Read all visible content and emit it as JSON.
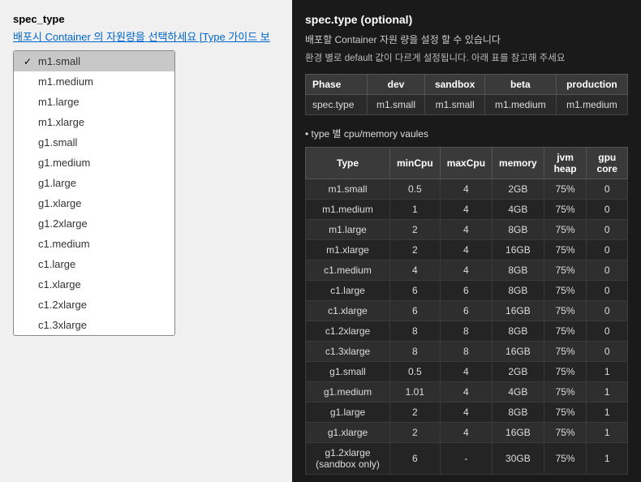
{
  "leftPanel": {
    "fieldLabel": "spec_type",
    "fieldSubtitle": "배포시 Container 의 자원량을 선택하세요 [Type 가이드 보",
    "items": [
      {
        "value": "m1.small",
        "selected": true
      },
      {
        "value": "m1.medium",
        "selected": false
      },
      {
        "value": "m1.large",
        "selected": false
      },
      {
        "value": "m1.xlarge",
        "selected": false
      },
      {
        "value": "g1.small",
        "selected": false
      },
      {
        "value": "g1.medium",
        "selected": false
      },
      {
        "value": "g1.large",
        "selected": false
      },
      {
        "value": "g1.xlarge",
        "selected": false
      },
      {
        "value": "g1.2xlarge",
        "selected": false
      },
      {
        "value": "c1.medium",
        "selected": false
      },
      {
        "value": "c1.large",
        "selected": false
      },
      {
        "value": "c1.xlarge",
        "selected": false
      },
      {
        "value": "c1.2xlarge",
        "selected": false
      },
      {
        "value": "c1.3xlarge",
        "selected": false
      }
    ]
  },
  "rightPanel": {
    "title": "spec.type (optional)",
    "desc": "배포할 Container 자원 량을 설정 할 수 있습니다",
    "note": "환경 별로 default 값이 다르게 설정됩니다. 아래 표를 참고해 주세요",
    "phaseTable": {
      "headers": [
        "Phase",
        "dev",
        "sandbox",
        "beta",
        "production"
      ],
      "rows": [
        [
          "spec.type",
          "m1.small",
          "m1.small",
          "m1.medium",
          "m1.medium"
        ]
      ]
    },
    "sectionTitle": "• type 별 cpu/memory vaules",
    "typeTable": {
      "headers": [
        "Type",
        "minCpu",
        "maxCpu",
        "memory",
        "jvm heap",
        "gpu core"
      ],
      "rows": [
        [
          "m1.small",
          "0.5",
          "4",
          "2GB",
          "75%",
          "0"
        ],
        [
          "m1.medium",
          "1",
          "4",
          "4GB",
          "75%",
          "0"
        ],
        [
          "m1.large",
          "2",
          "4",
          "8GB",
          "75%",
          "0"
        ],
        [
          "m1.xlarge",
          "2",
          "4",
          "16GB",
          "75%",
          "0"
        ],
        [
          "c1.medium",
          "4",
          "4",
          "8GB",
          "75%",
          "0"
        ],
        [
          "c1.large",
          "6",
          "6",
          "8GB",
          "75%",
          "0"
        ],
        [
          "c1.xlarge",
          "6",
          "6",
          "16GB",
          "75%",
          "0"
        ],
        [
          "c1.2xlarge",
          "8",
          "8",
          "8GB",
          "75%",
          "0"
        ],
        [
          "c1.3xlarge",
          "8",
          "8",
          "16GB",
          "75%",
          "0"
        ],
        [
          "g1.small",
          "0.5",
          "4",
          "2GB",
          "75%",
          "1"
        ],
        [
          "g1.medium",
          "1.01",
          "4",
          "4GB",
          "75%",
          "1"
        ],
        [
          "g1.large",
          "2",
          "4",
          "8GB",
          "75%",
          "1"
        ],
        [
          "g1.xlarge",
          "2",
          "4",
          "16GB",
          "75%",
          "1"
        ],
        [
          "g1.2xlarge\n(sandbox only)",
          "6",
          "-",
          "30GB",
          "75%",
          "1"
        ]
      ]
    }
  }
}
